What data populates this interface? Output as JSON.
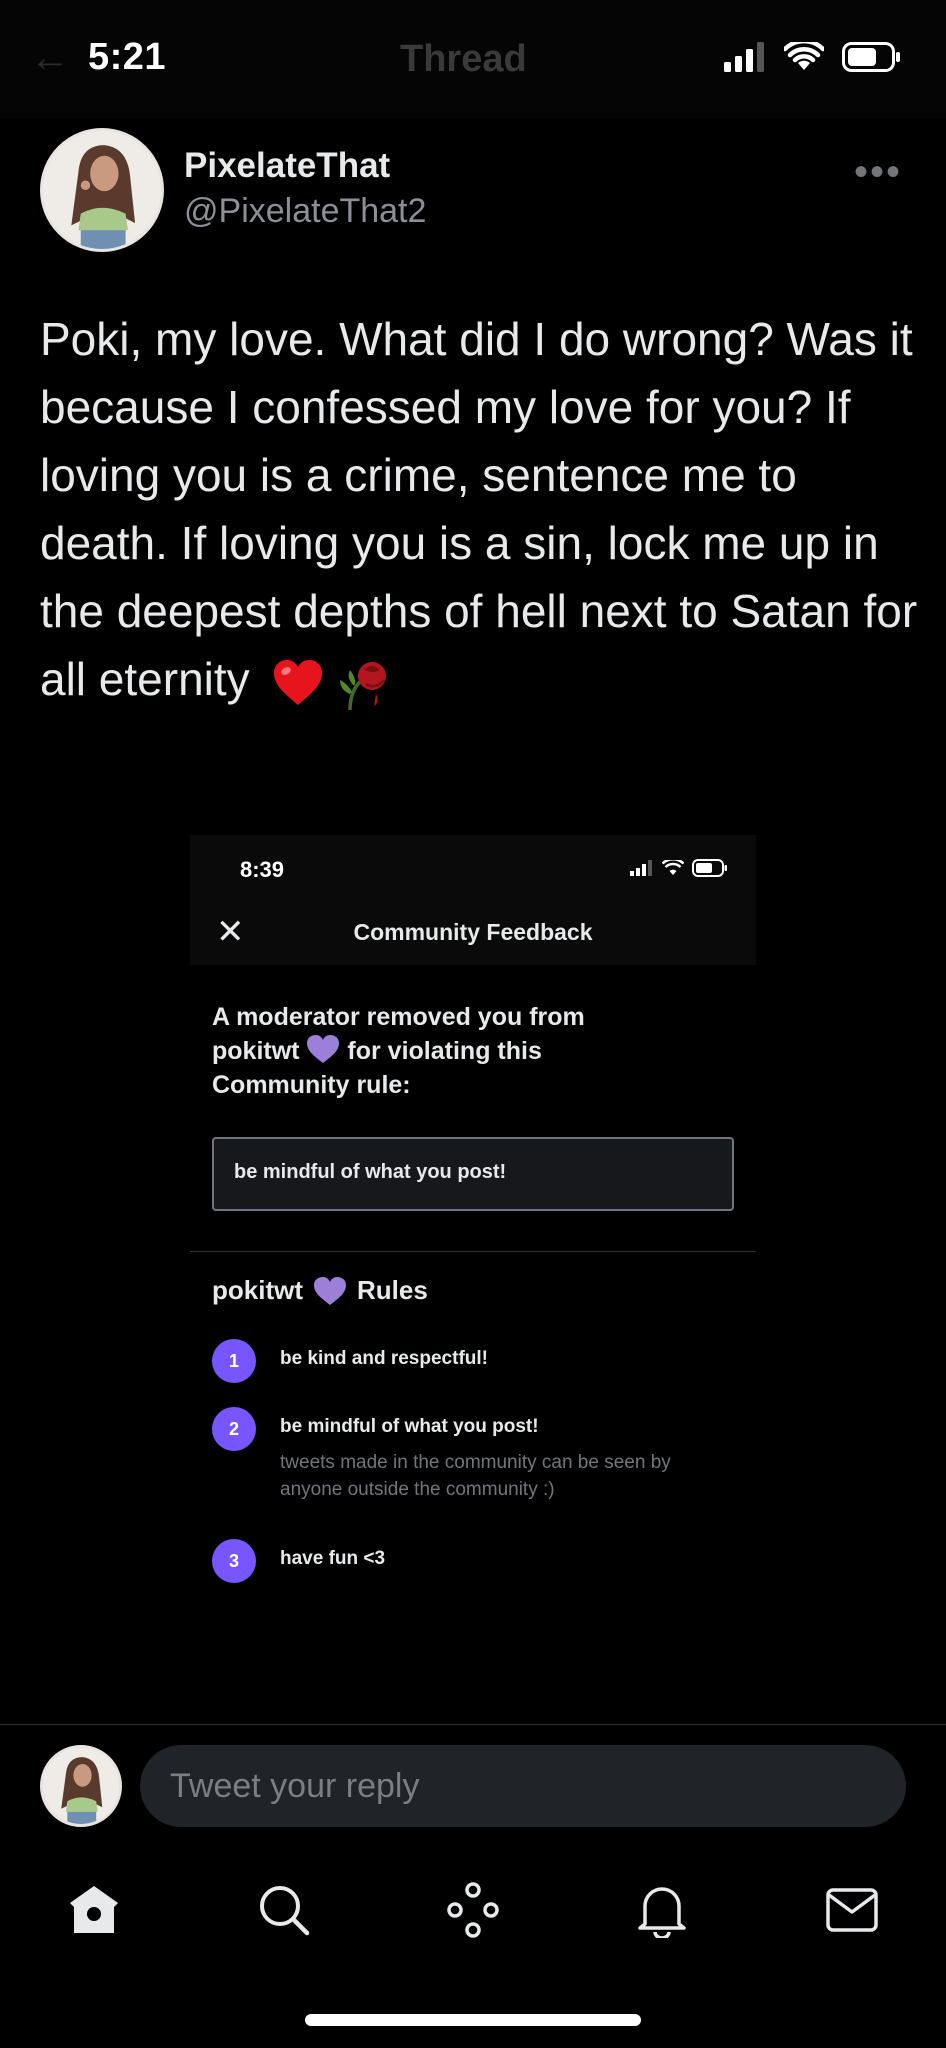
{
  "status_bar": {
    "time": "5:21"
  },
  "header": {
    "title": "Thread"
  },
  "tweet": {
    "author_name": "PixelateThat",
    "author_handle": "@PixelateThat2",
    "more_icon": "more-dots-icon",
    "text": "Poki, my love. What did I do wrong? Was it because I confessed my love for you? If loving you is a crime, sentence me to death. If loving you is a sin, lock me up in the deepest depths of hell next to Satan for all eternity",
    "emojis": [
      "heart-emoji",
      "wilted-rose-emoji"
    ]
  },
  "embedded_screenshot": {
    "status_time": "8:39",
    "title": "Community Feedback",
    "removed_line1": "A moderator removed you from",
    "removed_community": "pokitwt",
    "removed_line2": "for violating this",
    "removed_line3": "Community rule:",
    "violated_rule": "be mindful of what you post!",
    "rules_community": "pokitwt",
    "rules_label": "Rules",
    "rules": [
      {
        "number": "1",
        "title": "be kind and respectful!",
        "description": ""
      },
      {
        "number": "2",
        "title": "be mindful of what you post!",
        "description": "tweets made in the community can be seen by anyone outside the community :)"
      },
      {
        "number": "3",
        "title": "have fun <3",
        "description": ""
      }
    ],
    "accent_color": "#7856ff",
    "heart_color": "#9b7fd9"
  },
  "reply": {
    "placeholder": "Tweet your reply"
  },
  "tabbar": {
    "items": [
      "home-icon",
      "search-icon",
      "spaces-icon",
      "notifications-icon",
      "messages-icon"
    ]
  }
}
